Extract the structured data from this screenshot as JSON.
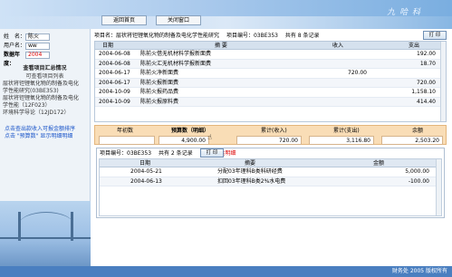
{
  "header": {
    "brand": "九 哈 科",
    "buttons": {
      "home": "返回首页",
      "close": "关闭窗口"
    }
  },
  "sidebar": {
    "name_label": "姓　名：",
    "name_value": "陈火",
    "user_label": "用户名：",
    "user_value": "ww",
    "year_label": "数据年度：",
    "year_value": "2004",
    "section_title": "查看项目汇总情况",
    "section_sub": "可查看项目列表",
    "projects": [
      "层状将钽锂氧化物的制备及电化",
      "学性能研究(03BE353)",
      "层状将钽锂氧化物的制备及电化",
      "学性能（12F023）",
      "环境科学导论（12JD172）"
    ],
    "hint": [
      "点击查出款收入可报金额排序",
      "点击 \"预算数\" 显示明细明细"
    ]
  },
  "project_bar": {
    "label": "项目名：",
    "name": "层状将钽锂氧化物的制备及电化学性能研究",
    "code_label": "项目编号：",
    "code": "03BE353",
    "count_text": "共有 8 条记录",
    "print": "打 印"
  },
  "ledger": {
    "columns": [
      "日期",
      "摘 要",
      "收入",
      "支出"
    ],
    "rows": [
      {
        "date": "2004-06-08",
        "summary": "陈前火借无机材料学报新面费",
        "income": "",
        "expense": "192.00"
      },
      {
        "date": "2004-06-08",
        "summary": "陈前火汇无机材料学报新面费",
        "income": "",
        "expense": "18.70"
      },
      {
        "date": "2004-06-17",
        "summary": "陈前火净新面费",
        "income": "720.00",
        "expense": ""
      },
      {
        "date": "2004-06-17",
        "summary": "陈前火报新面费",
        "income": "",
        "expense": "720.00"
      },
      {
        "date": "2004-10-09",
        "summary": "陈前火报药品费",
        "income": "",
        "expense": "1,158.10"
      },
      {
        "date": "2004-10-09",
        "summary": "陈前火报原料费",
        "income": "",
        "expense": "414.40"
      }
    ]
  },
  "summary": {
    "year_label": "年初数",
    "year_value": "",
    "budget_label": "预算数（明细）",
    "budget_value": "4,900.00",
    "income_label": "累计(收入)",
    "income_value": "720.00",
    "expense_label": "累计(支出)",
    "expense_value": "3,116.80",
    "balance_label": "余额",
    "balance_value": "2,503.20"
  },
  "detail": {
    "label": "项目编号：",
    "code": "03BE353",
    "count_text": "共有 2 条记录",
    "note": "预算下达明细",
    "print": "打 印",
    "columns": [
      "日期",
      "摘要",
      "金额"
    ],
    "rows": [
      {
        "date": "2004-05-21",
        "summary": "分配03年理科B类科研经费",
        "amount": "5,000.00"
      },
      {
        "date": "2004-06-13",
        "summary": "扣回03年理科B类2%水电费",
        "amount": "-100.00"
      }
    ]
  },
  "footer": {
    "copyright": "财务处 2005 版权所有"
  }
}
